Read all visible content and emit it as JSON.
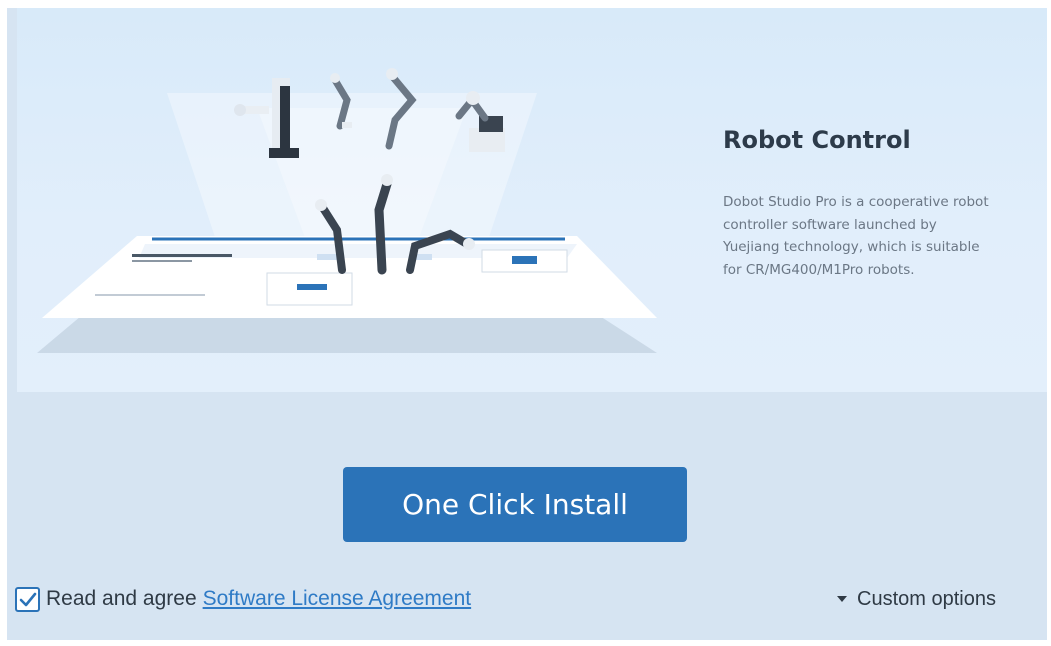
{
  "hero": {
    "title": "Robot Control",
    "description": "Dobot Studio Pro is a cooperative robot controller software launched by Yuejiang technology, which is suitable for CR/MG400/M1Pro robots."
  },
  "actions": {
    "install_label": "One Click Install"
  },
  "agreement": {
    "checked": true,
    "prefix": "Read and agree",
    "link_label": "Software License Agreement"
  },
  "options": {
    "custom_label": "Custom options"
  },
  "colors": {
    "accent": "#2b73b8",
    "link": "#2f7bc6",
    "background": "#d6e4f2"
  }
}
